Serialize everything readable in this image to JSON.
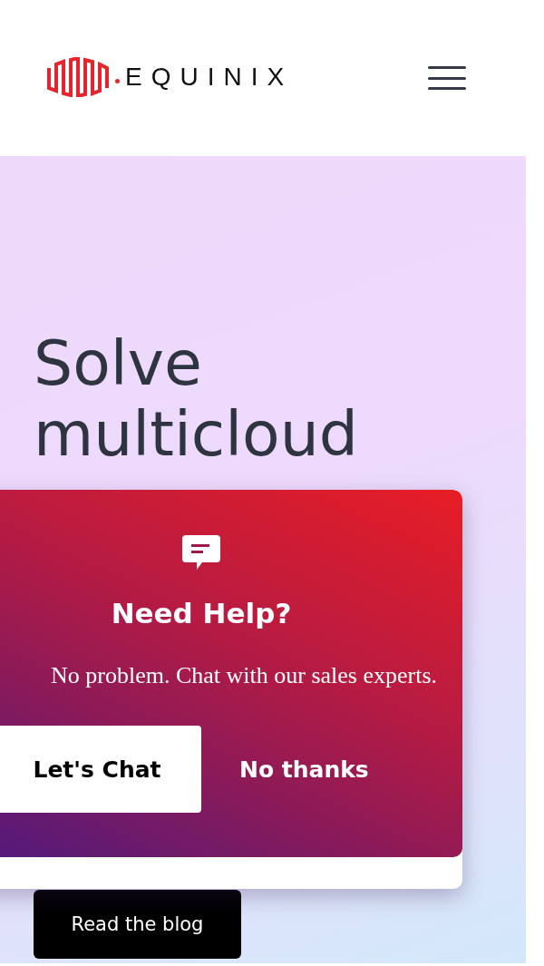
{
  "header": {
    "logo_text": "EQUINIX"
  },
  "hero": {
    "heading": [
      "Solve",
      "multicloud"
    ],
    "button": "Read the blog"
  },
  "chat_popup": {
    "title": "Need Help?",
    "message": "No problem. Chat with our sales experts.",
    "buttons": [
      {
        "label": "Let's Chat",
        "kind": "primary"
      },
      {
        "label": "No thanks",
        "kind": "text"
      }
    ]
  }
}
